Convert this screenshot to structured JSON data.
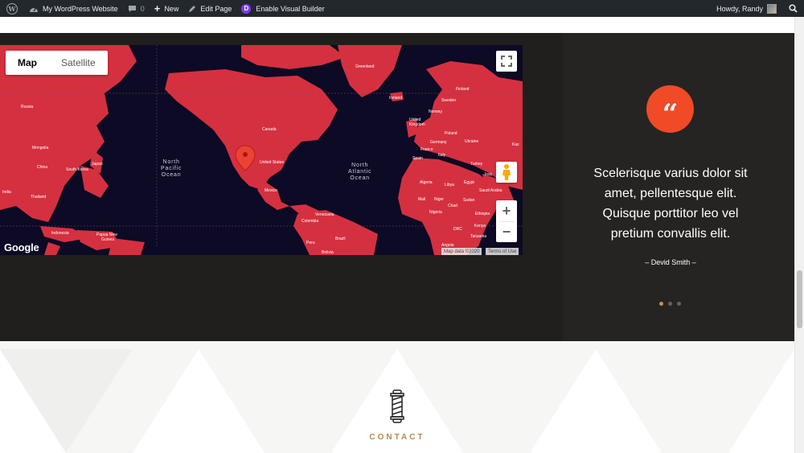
{
  "admin_bar": {
    "site_name": "My WordPress Website",
    "comments_count": "0",
    "new_label": "New",
    "edit_label": "Edit Page",
    "builder_label": "Enable Visual Builder",
    "greeting": "Howdy, Randy"
  },
  "map": {
    "type_map": "Map",
    "type_satellite": "Satellite",
    "zoom_in": "+",
    "zoom_out": "−",
    "google": "Google",
    "map_data": "Map data ©2020",
    "terms": "Terms of Use",
    "oceans": {
      "north_pacific": "North\nPacific\nOcean",
      "north_atlantic": "North\nAtlantic\nOcean"
    },
    "places": {
      "greenland": "Greenland",
      "iceland": "Iceland",
      "finland": "Finland",
      "sweden": "Sweden",
      "norway": "Norway",
      "uk": "United\nKingdom",
      "poland": "Poland",
      "germany": "Germany",
      "ukraine": "Ukraine",
      "france": "France",
      "spain": "Spain",
      "italy": "Italy",
      "turkey": "Turkey",
      "kaz": "Kaz",
      "iraq": "Iraq",
      "saudi": "Saudi Arabia",
      "egypt": "Egypt",
      "libya": "Libya",
      "algeria": "Algeria",
      "mali": "Mali",
      "niger": "Niger",
      "chad": "Chad",
      "sudan": "Sudan",
      "nigeria": "Nigeria",
      "ethiopia": "Ethiopia",
      "drc": "DRC",
      "kenya": "Kenya",
      "tanzania": "Tanzania",
      "angola": "Angola",
      "russia": "Russia",
      "mongolia": "Mongolia",
      "china": "China",
      "japan": "Japan",
      "south_korea": "South Korea",
      "india": "India",
      "thailand": "Thailand",
      "indonesia": "Indonesia",
      "png": "Papua New\nGuinea",
      "canada": "Canada",
      "usa": "United States",
      "mexico": "Mexico",
      "venezuela": "Venezuela",
      "colombia": "Colombia",
      "peru": "Peru",
      "brazil": "Brazil",
      "bolivia": "Bolivia"
    }
  },
  "testimonial": {
    "quote_icon": "“",
    "text": "Scelerisque varius dolor sit amet, pellentesque elit. Quisque porttitor leo vel pretium convallis elit.",
    "author": "– Devid Smith –",
    "slide_count": 3,
    "active_slide": 1
  },
  "contact": {
    "label": "CONTACT"
  },
  "colors": {
    "accent": "#f04a26",
    "land": "#d5303f",
    "water": "#0c0a24",
    "gold": "#b58a52"
  }
}
